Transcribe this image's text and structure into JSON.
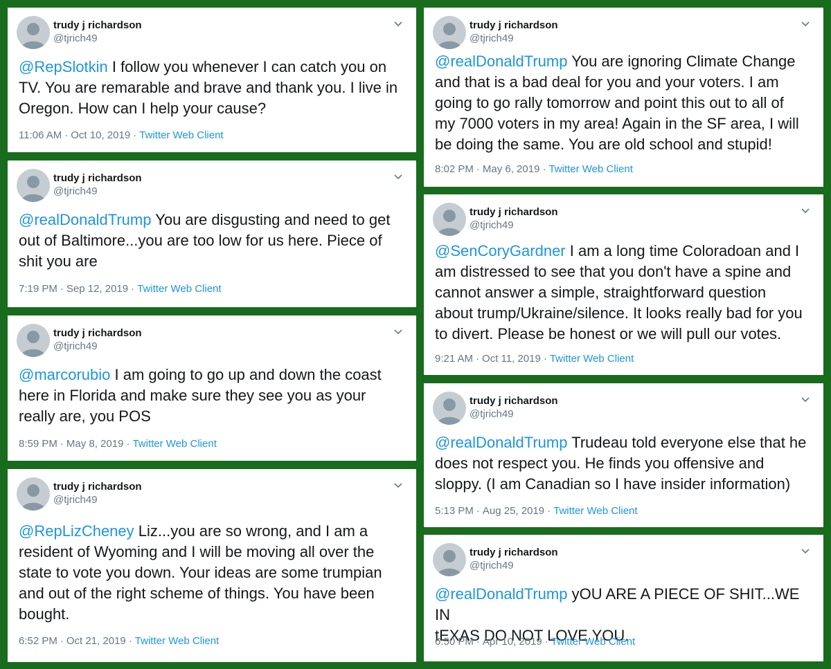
{
  "tweets": [
    {
      "name": "trudy j richardson",
      "handle": "@tjrich49",
      "mention": "@RepSlotkin",
      "text": " I follow you whenever I can catch you on\nTV. You are remarable and brave and thank you. I live in\nOregon. How can I help your cause?",
      "time": "11:06 AM",
      "date": "Oct 10, 2019",
      "source": "Twitter Web Client"
    },
    {
      "name": "trudy j richardson",
      "handle": "@tjrich49",
      "mention": "@realDonaldTrump",
      "text": " You are disgusting and need to get\nout of Baltimore...you are too low for us here.  Piece of\nshit you are",
      "time": "7:19 PM",
      "date": "Sep 12, 2019",
      "source": "Twitter Web Client"
    },
    {
      "name": "trudy j richardson",
      "handle": "@tjrich49",
      "mention": "@marcorubio",
      "text": " I am going to go up and down the coast\nhere in Florida and make sure they see you as your\nreally are, you POS",
      "time": "8:59 PM",
      "date": "May 8, 2019",
      "source": "Twitter Web Client"
    },
    {
      "name": "trudy j richardson",
      "handle": "@tjrich49",
      "mention": "@RepLizCheney",
      "text": " Liz...you are so wrong, and I am a\nresident of Wyoming and I will be moving all over the\nstate to vote you down. Your ideas are some trumpian\nand out of the right scheme of things.  You have been\nbought.",
      "time": "6:52 PM",
      "date": "Oct 21, 2019",
      "source": "Twitter Web Client"
    },
    {
      "name": "trudy j richardson",
      "handle": "@tjrich49",
      "mention": "@realDonaldTrump",
      "text": " You are ignoring Climate Change\nand that is a bad deal for you and your voters. I am\ngoing to go rally tomorrow and point this out to all of\nmy 7000 voters in my area!  Again in the SF area, I will\nbe doing the same.  You are old school and stupid!",
      "time": "8:02 PM",
      "date": "May 6, 2019",
      "source": "Twitter Web Client"
    },
    {
      "name": "trudy j richardson",
      "handle": "@tjrich49",
      "mention": "@SenCoryGardner",
      "text": " I am a long time Coloradoan and I\nam distressed to see that you don't have a spine and\ncannot answer a simple, straightforward question\nabout trump/Ukraine/silence. It looks really bad for you\nto divert. Please be honest or we will pull our votes.",
      "time": "9:21 AM",
      "date": "Oct 11, 2019",
      "source": "Twitter Web Client"
    },
    {
      "name": "trudy j richardson",
      "handle": "@tjrich49",
      "mention": "@realDonaldTrump",
      "text": " Trudeau told everyone else that he\ndoes not respect you. He finds you offensive and\nsloppy. (I am Canadian so I have insider information)",
      "time": "5:13 PM",
      "date": "Aug 25, 2019",
      "source": "Twitter Web Client"
    },
    {
      "name": "trudy j richardson",
      "handle": "@tjrich49",
      "mention": "@realDonaldTrump",
      "text": " yOU ARE A PIECE OF SHIT...WE IN\ntEXAS DO NOT LOVE YOU.",
      "time": "6:50 PM",
      "date": "Apr 10, 2019",
      "source": "Twitter Web Client"
    }
  ],
  "separator": "·",
  "colors": {
    "background": "#196b1d",
    "card": "#ffffff",
    "mention": "#1b95e0",
    "meta": "#657786"
  },
  "icons": {
    "avatar": "default-profile-icon",
    "caret": "chevron-down-icon"
  }
}
